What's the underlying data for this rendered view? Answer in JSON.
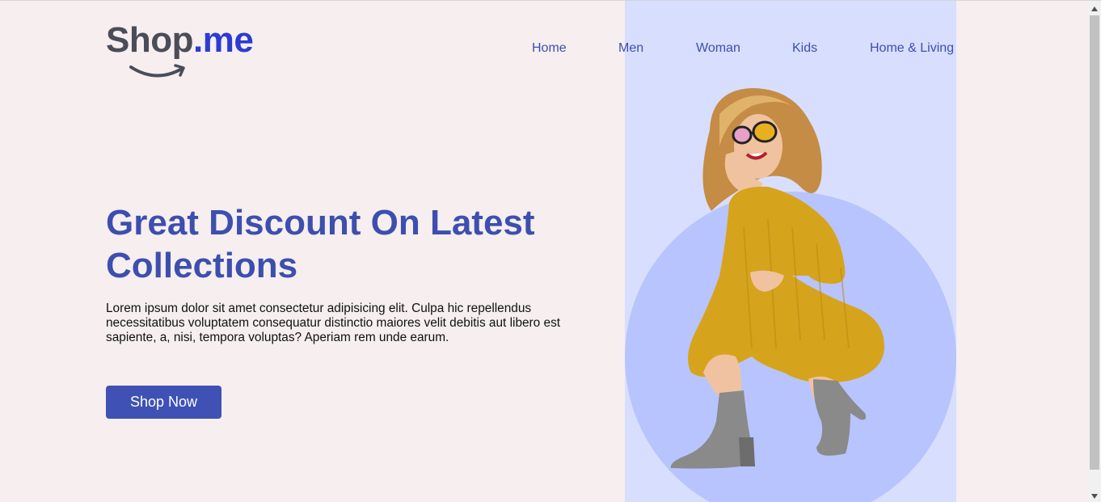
{
  "logo": {
    "part1": "Shop",
    "part2": ".me"
  },
  "nav": {
    "items": [
      {
        "label": "Home"
      },
      {
        "label": "Men"
      },
      {
        "label": "Woman"
      },
      {
        "label": "Kids"
      },
      {
        "label": "Home & Living"
      }
    ]
  },
  "hero": {
    "title": "Great Discount On Latest Collections",
    "description": "Lorem ipsum dolor sit amet consectetur adipisicing elit. Culpa hic repellendus necessitatibus voluptatem consequatur distinctio maiores velit debitis aut libero est sapiente, a, nisi, tempora voluptas? Aperiam rem unde earum.",
    "button_label": "Shop Now",
    "image_icon": "model-photo"
  },
  "colors": {
    "background": "#f6eeef",
    "accent": "#3f51b5",
    "panel": "#d8defd",
    "circle": "#b8c4fd"
  }
}
